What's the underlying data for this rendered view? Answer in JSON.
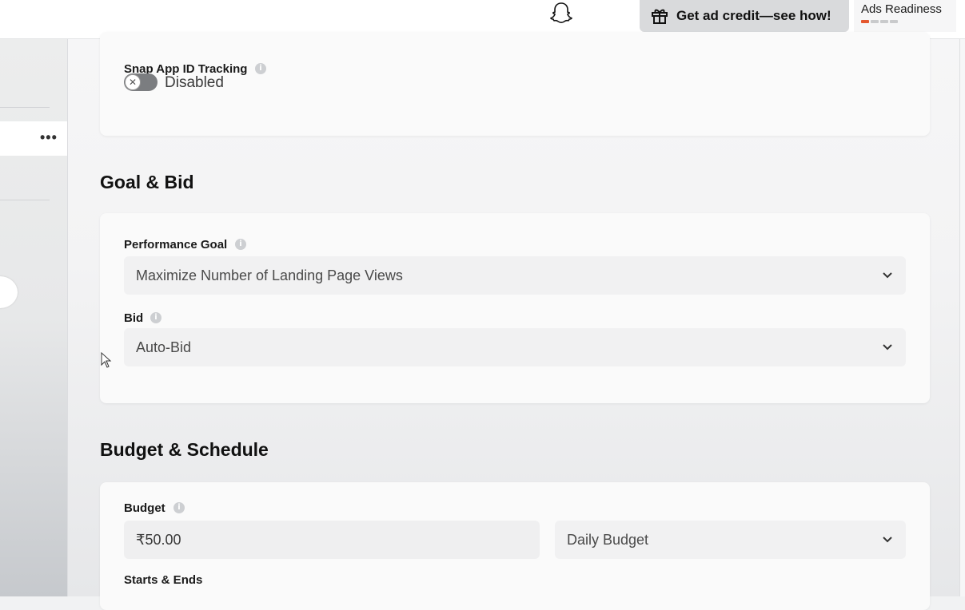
{
  "header": {
    "credit_button": "Get ad credit—see how!",
    "readiness_label": "Ads Readiness",
    "readiness_progress": {
      "completed": 1,
      "total": 4
    },
    "accent_color": "#e4572e"
  },
  "leftpane": {
    "more_label": "•••"
  },
  "tracking": {
    "label": "Snap App ID Tracking",
    "toggle_state": "Disabled",
    "toggle_on": false
  },
  "goal_bid": {
    "section_title": "Goal & Bid",
    "performance_goal_label": "Performance Goal",
    "performance_goal_value": "Maximize Number of Landing Page Views",
    "bid_label": "Bid",
    "bid_value": "Auto-Bid"
  },
  "budget_schedule": {
    "section_title": "Budget & Schedule",
    "budget_label": "Budget",
    "budget_amount": "₹50.00",
    "budget_type": "Daily Budget",
    "starts_ends_label": "Starts & Ends"
  },
  "icons": {
    "info": "i",
    "toggle_off": "✕"
  }
}
